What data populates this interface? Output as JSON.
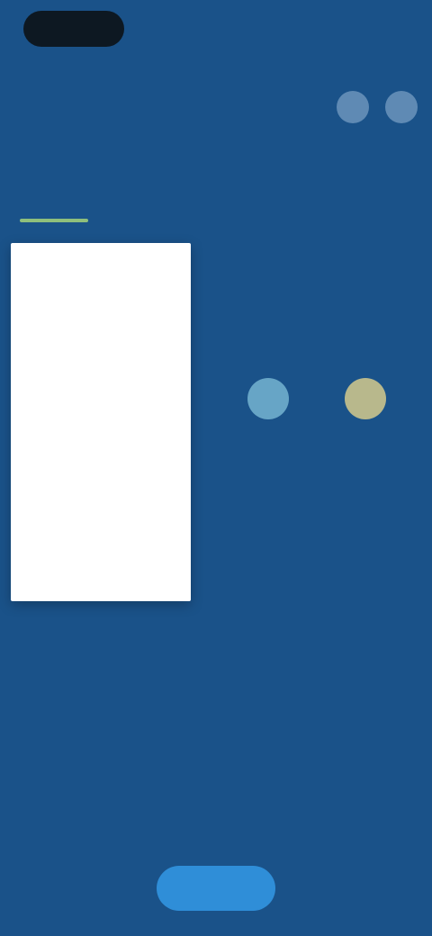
{
  "status_bar": {
    "pill_color": "#0d1822"
  },
  "header": {
    "back_label": "",
    "title": "",
    "actions": [
      {
        "icon": "search-icon",
        "glyph": ""
      },
      {
        "icon": "more-icon",
        "glyph": ""
      }
    ]
  },
  "subtitle": "",
  "tabs": [
    {
      "label": "",
      "active": true
    },
    {
      "label": "",
      "active": false
    },
    {
      "label": "",
      "active": false
    }
  ],
  "panel": {
    "items": [
      "",
      "",
      "",
      "",
      "",
      "",
      ""
    ]
  },
  "contacts": [
    {
      "label": "",
      "color": "#67a5c6"
    },
    {
      "label": "",
      "color": "#b8b88c"
    }
  ],
  "primary_button": {
    "label": ""
  },
  "colors": {
    "background": "#1a5289",
    "accent": "#2f8ed8",
    "tab_indicator": "#8fbf7c",
    "panel": "#ffffff"
  }
}
